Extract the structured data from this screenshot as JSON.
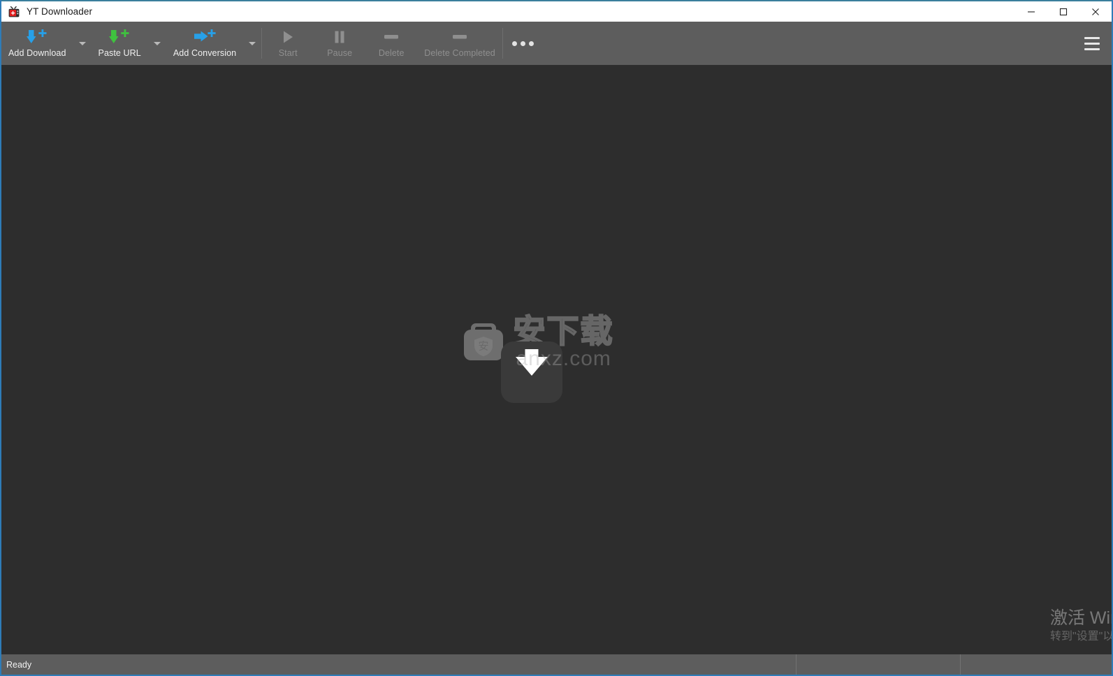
{
  "window": {
    "title": "YT Downloader",
    "app_icon": "retro-tv-icon",
    "accent_color": "#2e7cb8",
    "titlebar_bg": "#ffffff",
    "toolbar_bg": "#5d5d5d",
    "content_bg": "#2d2d2d",
    "controls": {
      "minimize": "minimize",
      "maximize": "maximize",
      "close": "close"
    }
  },
  "toolbar": {
    "items": [
      {
        "label": "Add Download",
        "icon": "download-plus-icon",
        "icon_color": "#27a0e8",
        "enabled": true,
        "has_dropdown": true
      },
      {
        "label": "Paste URL",
        "icon": "paste-plus-icon",
        "icon_color": "#3fc23f",
        "enabled": true,
        "has_dropdown": true
      },
      {
        "label": "Add Conversion",
        "icon": "convert-plus-icon",
        "icon_color": "#27a0e8",
        "enabled": true,
        "has_dropdown": true
      },
      {
        "label": "Start",
        "icon": "play-icon",
        "icon_color": "#8f8f8f",
        "enabled": false,
        "has_dropdown": false
      },
      {
        "label": "Pause",
        "icon": "pause-icon",
        "icon_color": "#8f8f8f",
        "enabled": false,
        "has_dropdown": false
      },
      {
        "label": "Delete",
        "icon": "minus-icon",
        "icon_color": "#8f8f8f",
        "enabled": false,
        "has_dropdown": false
      },
      {
        "label": "Delete Completed",
        "icon": "minus-icon",
        "icon_color": "#8f8f8f",
        "enabled": false,
        "has_dropdown": false
      }
    ],
    "more_button": "more-options-icon",
    "menu_button": "hamburger-menu-icon"
  },
  "content": {
    "empty": true,
    "watermark": {
      "logo_name": "anxz-toolbox-logo",
      "text": "安下载",
      "subtext": "anxz.com",
      "download_badge": "download-arrow-icon"
    }
  },
  "activation": {
    "line1": "激活 Win",
    "line2": "转到\"设置\"以"
  },
  "statusbar": {
    "message": "Ready",
    "cell2": "",
    "cell3": ""
  }
}
